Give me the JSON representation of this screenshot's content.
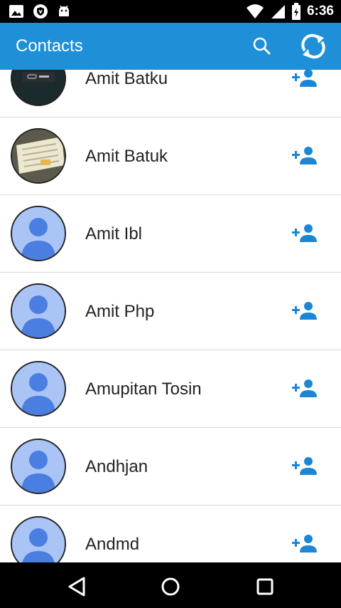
{
  "status_bar": {
    "time": "6:36",
    "icons_left": [
      "gallery-icon",
      "shield-icon",
      "android-icon"
    ],
    "icons_right": [
      "wifi-icon",
      "signal-icon",
      "battery-icon"
    ]
  },
  "app_bar": {
    "title": "Contacts",
    "background_color": "#1f8fd8",
    "actions": [
      "search-icon",
      "sync-icon"
    ]
  },
  "contacts": [
    {
      "name": "Amit Batku",
      "avatar": "photo-dark"
    },
    {
      "name": "Amit Batuk",
      "avatar": "photo-document"
    },
    {
      "name": "Amit Ibl",
      "avatar": "default"
    },
    {
      "name": "Amit Php",
      "avatar": "default"
    },
    {
      "name": "Amupitan Tosin",
      "avatar": "default"
    },
    {
      "name": "Andhjan",
      "avatar": "default"
    },
    {
      "name": "Andmd",
      "avatar": "default"
    }
  ],
  "row_action_icon": "add-person-icon",
  "accent_color": "#1a86d6",
  "nav_bar": {
    "buttons": [
      "back-icon",
      "home-icon",
      "recents-icon"
    ]
  }
}
